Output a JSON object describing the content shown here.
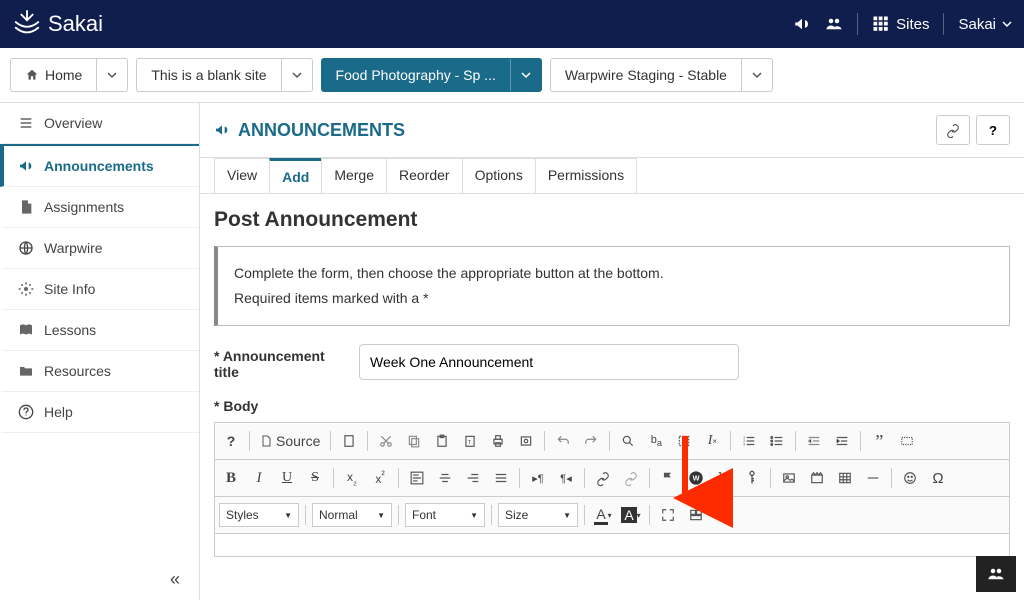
{
  "brand": {
    "name": "Sakai"
  },
  "topbar": {
    "sites": "Sites",
    "user": "Sakai"
  },
  "sitenav": {
    "items": [
      {
        "label": "Home"
      },
      {
        "label": "This is a blank site"
      },
      {
        "label": "Food Photography - Sp ..."
      },
      {
        "label": "Warpwire Staging - Stable"
      }
    ]
  },
  "sidebar": {
    "items": [
      {
        "label": "Overview"
      },
      {
        "label": "Announcements"
      },
      {
        "label": "Assignments"
      },
      {
        "label": "Warpwire"
      },
      {
        "label": "Site Info"
      },
      {
        "label": "Lessons"
      },
      {
        "label": "Resources"
      },
      {
        "label": "Help"
      }
    ]
  },
  "tool": {
    "title": "ANNOUNCEMENTS",
    "help": "?"
  },
  "tabs": {
    "items": [
      {
        "label": "View"
      },
      {
        "label": "Add"
      },
      {
        "label": "Merge"
      },
      {
        "label": "Reorder"
      },
      {
        "label": "Options"
      },
      {
        "label": "Permissions"
      }
    ]
  },
  "page": {
    "heading": "Post Announcement",
    "info_line1": "Complete the form, then choose the appropriate button at the bottom.",
    "info_line2": "Required items marked with a *",
    "title_label": "* Announcement title",
    "title_value": "Week One Announcement",
    "body_label": "* Body"
  },
  "rte": {
    "source": "Source",
    "styles": "Styles",
    "format": "Normal",
    "font": "Font",
    "size": "Size"
  }
}
